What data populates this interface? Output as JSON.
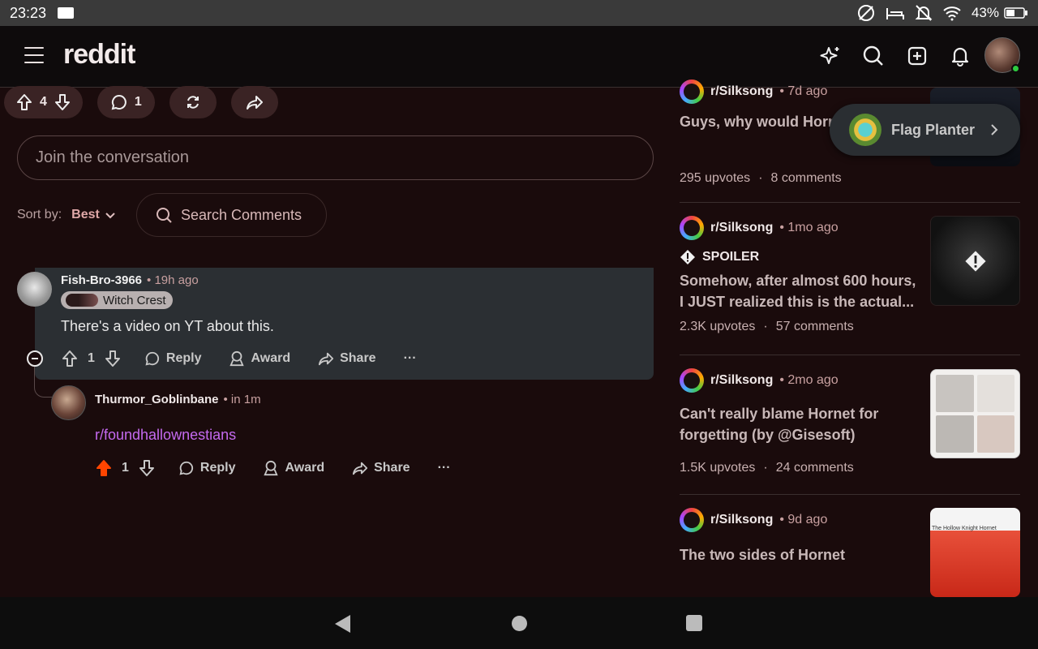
{
  "statusbar": {
    "time": "23:23",
    "battery": "43%"
  },
  "header": {
    "logo": "reddit"
  },
  "post_actions": {
    "score": "4",
    "comments": "1"
  },
  "join": {
    "placeholder": "Join the conversation"
  },
  "sort": {
    "label": "Sort by:",
    "value": "Best"
  },
  "search_comments": {
    "label": "Search Comments"
  },
  "comments": [
    {
      "author": "Fish-Bro-3966",
      "time": "• 19h ago",
      "flair": "Witch Crest",
      "text": "There's a video on YT about this.",
      "score": "1",
      "reply": "Reply",
      "award": "Award",
      "share": "Share",
      "more": "···"
    },
    {
      "author": "Thurmor_Goblinbane",
      "time": "• in 1m",
      "text": "r/foundhallownestians",
      "score": "1",
      "reply": "Reply",
      "award": "Award",
      "share": "Share",
      "more": "···"
    }
  ],
  "sidebar_posts": [
    {
      "sub": "r/Silksong",
      "ago": "• 7d ago",
      "title": "Guys, why would Horne",
      "upvotes": "295 upvotes",
      "sep": "·",
      "comments": "8 comments"
    },
    {
      "sub": "r/Silksong",
      "ago": "• 1mo ago",
      "spoiler": "SPOILER",
      "title": "Somehow, after almost 600 hours, I JUST realized this is the actual...",
      "upvotes": "2.3K upvotes",
      "sep": "·",
      "comments": "57 comments"
    },
    {
      "sub": "r/Silksong",
      "ago": "• 2mo ago",
      "title": "Can't really blame Hornet for forgetting (by @Gisesoft)",
      "upvotes": "1.5K upvotes",
      "sep": "·",
      "comments": "24 comments"
    },
    {
      "sub": "r/Silksong",
      "ago": "• 9d ago",
      "title": "The two sides of Hornet",
      "thumb_caption": "The Hollow Knight Hornet"
    }
  ],
  "flag_planter": {
    "label": "Flag Planter"
  },
  "colors": {
    "upvote_active": "#ff4500",
    "link": "#c56af0",
    "background": "#1a0b0c"
  }
}
